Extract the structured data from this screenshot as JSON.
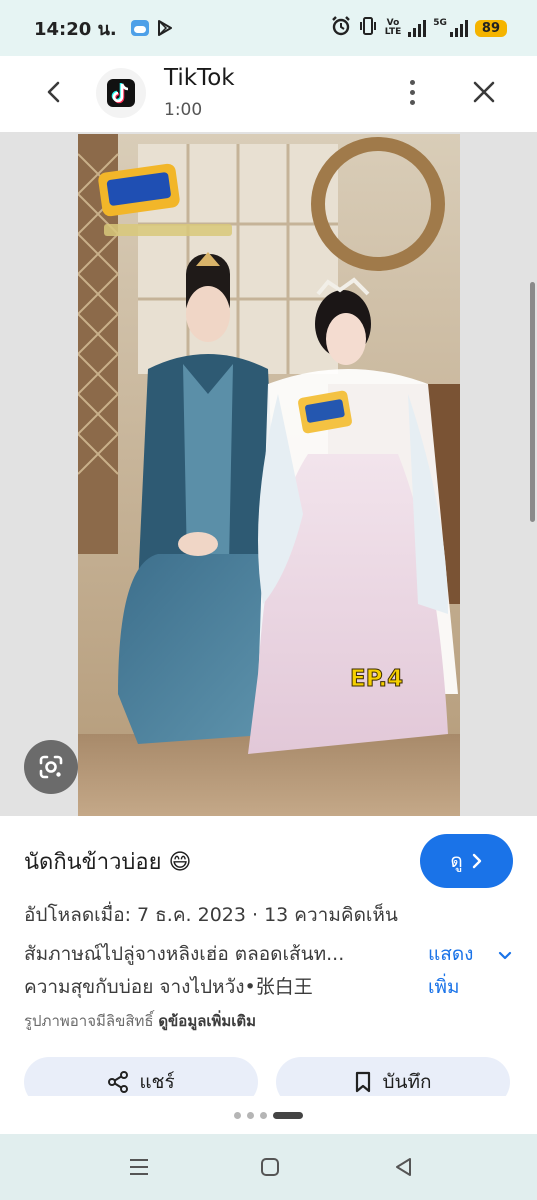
{
  "status_bar": {
    "time": "14:20 น.",
    "network_label_top": "Vo",
    "network_label_bottom": "LTE",
    "network_gen": "5G",
    "battery": "89"
  },
  "header": {
    "app_name": "TikTok",
    "duration": "1:00"
  },
  "photo": {
    "badge_text": "EP.4"
  },
  "info": {
    "title": "นัดกินข้าวบ่อย 😄",
    "view_label": "ดู",
    "meta": "อัปโหลดเมื่อ: 7 ธ.ค. 2023 · 13 ความคิดเห็น",
    "desc_line1": "สัมภาษณ์ไปลู่จางหลิงเฮ่อ ตลอดเส้นท...",
    "desc_line2": "ความสุขกับบ่อย จางไปหวัง•张白王",
    "more_line1": "แสดง",
    "more_line2": "เพิ่ม",
    "copyright": "รูปภาพอาจมีลิขสิทธิ์",
    "copyright_link": "ดูข้อมูลเพิ่มเติม",
    "share_label": "แชร์",
    "save_label": "บันทึก"
  },
  "colors": {
    "accent": "#1a73e8",
    "battery": "#f5b400",
    "pill_bg": "#e9eef9"
  },
  "pager": {
    "count": 4,
    "active_index": 3
  }
}
